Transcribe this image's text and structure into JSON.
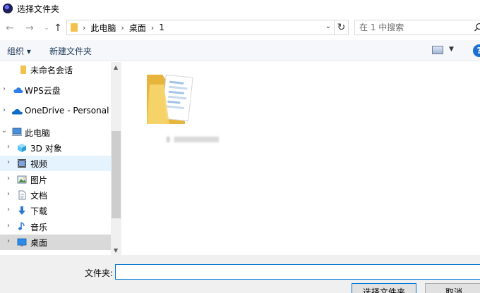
{
  "window": {
    "title": "选择文件夹"
  },
  "address": {
    "breadcrumb": [
      "此电脑",
      "桌面",
      "1"
    ],
    "search_placeholder": "在 1 中搜索"
  },
  "toolbar": {
    "organize_label": "组织 ▾",
    "new_folder_label": "新建文件夹",
    "help_label": "?"
  },
  "nav": {
    "items": [
      {
        "label": "未命名会话",
        "icon": "folder-icon",
        "expandable": false
      },
      {
        "label": "WPS云盘",
        "icon": "cloud-icon",
        "expandable": true
      },
      {
        "label": "OneDrive - Personal",
        "icon": "onedrive-icon",
        "expandable": true
      },
      {
        "label": "此电脑",
        "icon": "computer-icon",
        "expandable": true,
        "expanded": true
      },
      {
        "label": "3D 对象",
        "icon": "cube-icon",
        "expandable": true
      },
      {
        "label": "视频",
        "icon": "video-icon",
        "expandable": true,
        "state": "hover"
      },
      {
        "label": "图片",
        "icon": "picture-icon",
        "expandable": true
      },
      {
        "label": "文档",
        "icon": "document-icon",
        "expandable": true
      },
      {
        "label": "下载",
        "icon": "download-icon",
        "expandable": true
      },
      {
        "label": "音乐",
        "icon": "music-icon",
        "expandable": true
      },
      {
        "label": "桌面",
        "icon": "desktop-icon",
        "expandable": true,
        "state": "current"
      }
    ]
  },
  "content": {
    "items": [
      {
        "icon": "folder-with-documents-icon"
      }
    ]
  },
  "footer": {
    "folder_label": "文件夹:",
    "folder_value": "",
    "select_button": "选择文件夹",
    "cancel_button": "取消"
  },
  "colors": {
    "accent": "#0078d7",
    "selection": "#cce8ff",
    "hover": "#e5f3ff",
    "folder": "#f2c14e"
  }
}
